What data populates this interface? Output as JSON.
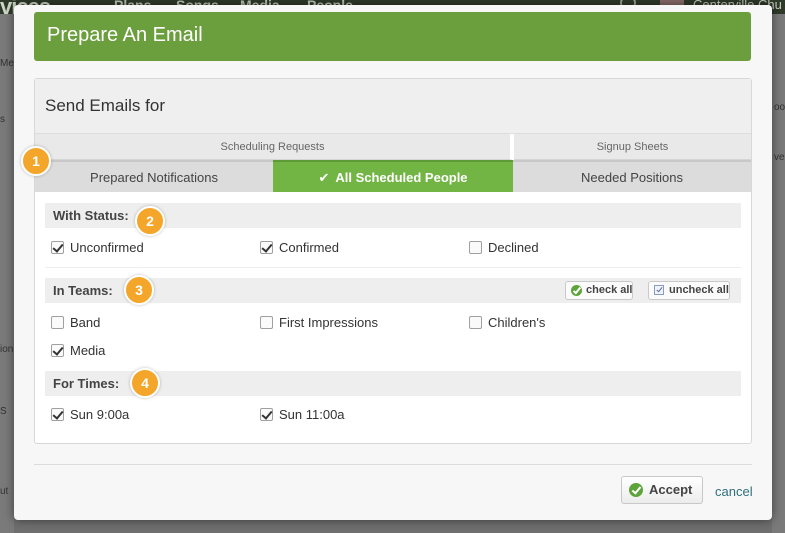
{
  "background": {
    "logo_text": "vices",
    "nav": [
      "Plans",
      "Songs",
      "Media",
      "People"
    ],
    "church_name": "Centerville Chu",
    "left_fragments": [
      "Me",
      "s",
      "ion",
      "S",
      "ut"
    ],
    "right_fragments": [
      "oo",
      "ve"
    ]
  },
  "modal": {
    "title": "Prepare An Email",
    "section_title": "Send Emails for",
    "groups": {
      "scheduling": "Scheduling Requests",
      "signup": "Signup Sheets"
    },
    "tabs": {
      "prepared": "Prepared Notifications",
      "all_scheduled": "All Scheduled People",
      "needed": "Needed Positions"
    },
    "status": {
      "heading": "With Status:",
      "options": [
        {
          "label": "Unconfirmed",
          "checked": true
        },
        {
          "label": "Confirmed",
          "checked": true
        },
        {
          "label": "Declined",
          "checked": false
        }
      ]
    },
    "teams": {
      "heading": "In Teams:",
      "check_all": "check all",
      "uncheck_all": "uncheck all",
      "options": [
        {
          "label": "Band",
          "checked": false
        },
        {
          "label": "First Impressions",
          "checked": false
        },
        {
          "label": "Children's",
          "checked": false
        },
        {
          "label": "Media",
          "checked": true
        }
      ]
    },
    "times": {
      "heading": "For Times:",
      "options": [
        {
          "label": "Sun 9:00a",
          "checked": true
        },
        {
          "label": "Sun 11:00a",
          "checked": true
        }
      ]
    },
    "badges": [
      "1",
      "2",
      "3",
      "4"
    ],
    "accept": "Accept",
    "cancel": "cancel"
  },
  "colors": {
    "header_green": "#6b9f3e",
    "active_tab_green": "#72b545",
    "badge_orange": "#f4a62a"
  }
}
